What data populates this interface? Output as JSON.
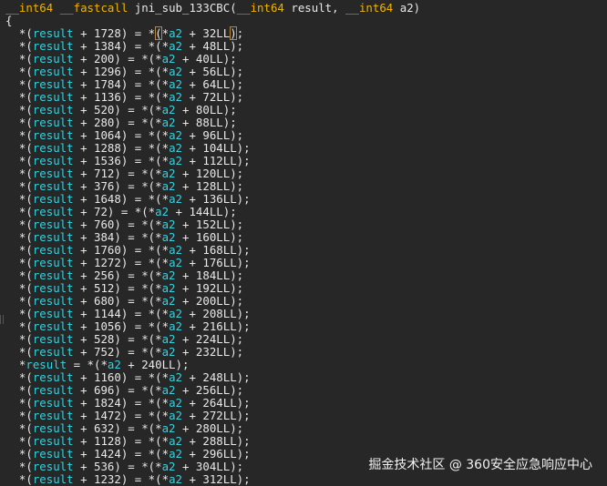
{
  "header": {
    "ret_type": "__int64",
    "call_conv": "__fastcall",
    "func_name": "jni_sub_133CBC",
    "open_paren": "(",
    "param1_type": "__int64",
    "param1_name": "result",
    "comma": ", ",
    "param2_type": "__int64",
    "param2_name": "a2",
    "close_paren": ")"
  },
  "open_brace": "{",
  "dst_var": "result",
  "src_var": "a2",
  "highlight_line_index": 0,
  "lines": [
    {
      "dst": "1728",
      "src": "32"
    },
    {
      "dst": "1384",
      "src": "48"
    },
    {
      "dst": "200",
      "src": "40"
    },
    {
      "dst": "1296",
      "src": "56"
    },
    {
      "dst": "1784",
      "src": "64"
    },
    {
      "dst": "1136",
      "src": "72"
    },
    {
      "dst": "520",
      "src": "80"
    },
    {
      "dst": "280",
      "src": "88"
    },
    {
      "dst": "1064",
      "src": "96"
    },
    {
      "dst": "1288",
      "src": "104"
    },
    {
      "dst": "1536",
      "src": "112"
    },
    {
      "dst": "712",
      "src": "120"
    },
    {
      "dst": "376",
      "src": "128"
    },
    {
      "dst": "1648",
      "src": "136"
    },
    {
      "dst": "72",
      "src": "144"
    },
    {
      "dst": "760",
      "src": "152"
    },
    {
      "dst": "384",
      "src": "160"
    },
    {
      "dst": "1760",
      "src": "168"
    },
    {
      "dst": "1272",
      "src": "176"
    },
    {
      "dst": "256",
      "src": "184"
    },
    {
      "dst": "512",
      "src": "192"
    },
    {
      "dst": "680",
      "src": "200"
    },
    {
      "dst": "1144",
      "src": "208"
    },
    {
      "dst": "1056",
      "src": "216"
    },
    {
      "dst": "528",
      "src": "224"
    },
    {
      "dst": "752",
      "src": "232"
    },
    {
      "dst": null,
      "src": "240"
    },
    {
      "dst": "1160",
      "src": "248"
    },
    {
      "dst": "696",
      "src": "256"
    },
    {
      "dst": "1824",
      "src": "264"
    },
    {
      "dst": "1472",
      "src": "272"
    },
    {
      "dst": "632",
      "src": "280"
    },
    {
      "dst": "1128",
      "src": "288"
    },
    {
      "dst": "1424",
      "src": "296"
    },
    {
      "dst": "536",
      "src": "304"
    },
    {
      "dst": "1232",
      "src": "312"
    }
  ],
  "watermark": "掘金技术社区 @ 360安全应急响应中心"
}
